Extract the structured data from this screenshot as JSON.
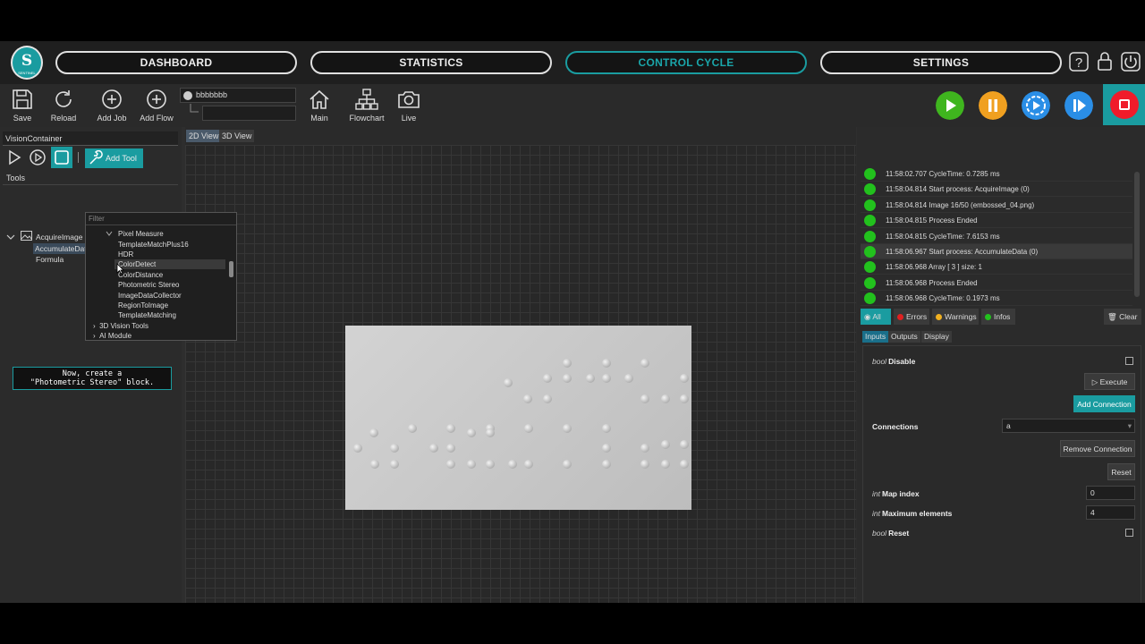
{
  "app": {
    "logo_text": "S",
    "logo_sub": "SENTINEL"
  },
  "nav": [
    "DASHBOARD",
    "STATISTICS",
    "CONTROL CYCLE",
    "SETTINGS"
  ],
  "toolbar": {
    "save": "Save",
    "reload": "Reload",
    "add_job": "Add Job",
    "add_flow": "Add Flow",
    "job_value": "bbbbbbb",
    "main": "Main",
    "flowchart": "Flowchart",
    "live": "Live"
  },
  "left": {
    "container": "VisionContainer",
    "add_tool": "Add Tool",
    "tools_header": "Tools",
    "tree": [
      "AcquireImage",
      "AccumulateData",
      "Formula"
    ],
    "hint_line1": "Now, create a",
    "hint_line2": "\"Photometric Stereo\" block."
  },
  "dropdown": {
    "filter_placeholder": "Filter",
    "items": [
      "Pixel Measure",
      "TemplateMatchPlus16",
      "HDR",
      "ColorDetect",
      "ColorDistance",
      "Photometric Stereo",
      "ImageDataCollector",
      "RegionToImage",
      "TemplateMatching"
    ],
    "groups": [
      "3D Vision Tools",
      "AI Module"
    ]
  },
  "center": {
    "tab_2d": "2D View",
    "tab_3d": "3D View"
  },
  "log": [
    "11:58:02.707 CycleTime: 0.7285 ms",
    "11:58:04.814 Start process: AcquireImage (0)",
    "11:58:04.814 Image 16/50 (embossed_04.png)",
    "11:58:04.815 Process Ended",
    "11:58:04.815 CycleTime: 7.6153 ms",
    "11:58:06.967 Start process: AccumulateData (0)",
    "11:58:06.968 Array [ 3 ] size: 1",
    "11:58:06.968 Process Ended",
    "11:58:06.968 CycleTime: 0.1973 ms"
  ],
  "log_filters": {
    "all": "All",
    "errors": "Errors",
    "warnings": "Warnings",
    "infos": "Infos",
    "clear": "Clear"
  },
  "props_tabs": [
    "Inputs",
    "Outputs",
    "Display"
  ],
  "props": {
    "bool_type": "bool",
    "int_type": "int",
    "disable": "Disable",
    "execute": "Execute",
    "add_connection": "Add Connection",
    "connections": "Connections",
    "connections_value": "a",
    "remove_connection": "Remove Connection",
    "reset_btn": "Reset",
    "map_index": "Map index",
    "map_index_value": "0",
    "max_elements": "Maximum elements",
    "max_elements_value": "4",
    "reset": "Reset"
  },
  "colors": {
    "accent": "#1a9ca0",
    "ok": "#22c11d",
    "stop": "#f01b2a",
    "pause": "#f0a020",
    "play": "#3fb51e",
    "step": "#2a8ee6"
  }
}
